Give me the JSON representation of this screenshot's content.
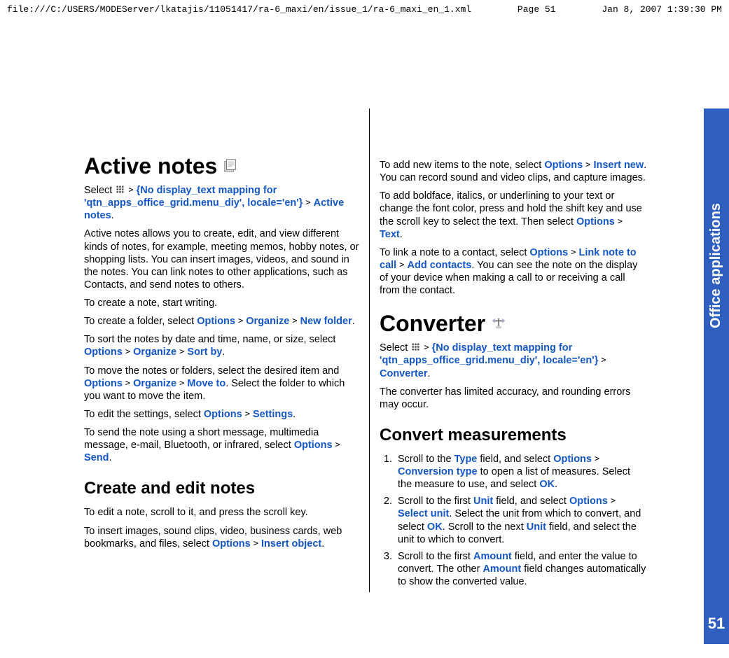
{
  "header": {
    "path": "file:///C:/USERS/MODEServer/lkatajis/11051417/ra-6_maxi/en/issue_1/ra-6_maxi_en_1.xml",
    "page": "Page 51",
    "datetime": "Jan 8, 2007 1:39:30 PM"
  },
  "side": {
    "section": "Office applications",
    "page_number": "51"
  },
  "left": {
    "h1": "Active notes",
    "p_select_pre": "Select ",
    "p_select_mapping": "{No display_text mapping for 'qtn_apps_office_grid.menu_diy', locale='en'}",
    "p_select_end": "Active notes",
    "p_desc": "Active notes allows you to create, edit, and view different kinds of notes, for example, meeting memos, hobby notes, or shopping lists. You can insert images, videos, and sound in the notes. You can link notes to other applications, such as Contacts, and send notes to others.",
    "p_create_note": "To create a note, start writing.",
    "p_folder_pre": "To create a folder, select ",
    "p_folder_opt": "Options",
    "p_folder_org": "Organize",
    "p_folder_nf": "New folder",
    "p_sort_pre": "To sort the notes by date and time, name, or size, select ",
    "p_sort_opt": "Options",
    "p_sort_org": "Organize",
    "p_sort_sb": "Sort by",
    "p_move_pre": "To move the notes or folders, select the desired item and ",
    "p_move_opt": "Options",
    "p_move_org": "Organize",
    "p_move_mt": "Move to",
    "p_move_end": ". Select the folder to which you want to move the item.",
    "p_settings_pre": "To edit the settings, select ",
    "p_settings_opt": "Options",
    "p_settings_set": "Settings",
    "p_send_pre": "To send the note using a short message, multimedia message, e-mail, Bluetooth, or infrared, select ",
    "p_send_opt": "Options",
    "p_send_snd": "Send",
    "h2": "Create and edit notes",
    "p_edit": "To edit a note, scroll to it, and press the scroll key.",
    "p_insert_pre": "To insert images, sound clips, video, business cards, web bookmarks, and files, select ",
    "p_insert_opt": "Options",
    "p_insert_obj": "Insert object"
  },
  "right": {
    "p_add_pre": "To add new items to the note, select ",
    "p_add_opt": "Options",
    "p_add_in": "Insert new",
    "p_add_end": ". You can record sound and video clips, and capture images.",
    "p_bf_pre": "To add boldface, italics, or underlining to your text or change the font color, press and hold the shift key and use the scroll key to select the text. Then select ",
    "p_bf_opt": "Options",
    "p_bf_txt": "Text",
    "p_link_pre": "To link a note to a contact, select ",
    "p_link_opt": "Options",
    "p_link_lnc": "Link note to call",
    "p_link_ac": "Add contacts",
    "p_link_end": ". You can see the note on the display of your device when making a call to or receiving a call from the contact.",
    "h1": "Converter",
    "p_sel_pre": "Select ",
    "p_sel_map": "{No display_text mapping for 'qtn_apps_office_grid.menu_diy', locale='en'}",
    "p_sel_cv": "Converter",
    "p_acc": "The converter has limited accuracy, and rounding errors may occur.",
    "h2": "Convert measurements",
    "li1_pre": "Scroll to the ",
    "li1_type": "Type",
    "li1_mid1": " field, and select ",
    "li1_opt": "Options",
    "li1_ct": "Conversion type",
    "li1_mid2": " to open a list of measures. Select the measure to use, and select ",
    "li1_ok": "OK",
    "li2_pre": "Scroll to the first ",
    "li2_unit": "Unit",
    "li2_mid1": " field, and select ",
    "li2_opt": "Options",
    "li2_su": "Select unit",
    "li2_mid2": ". Select the unit from which to convert, and select ",
    "li2_ok": "OK",
    "li2_mid3": ". Scroll to the next ",
    "li2_unit2": "Unit",
    "li2_end": " field, and select the unit to which to convert.",
    "li3_pre": "Scroll to the first ",
    "li3_am": "Amount",
    "li3_mid1": " field, and enter the value to convert. The other ",
    "li3_am2": "Amount",
    "li3_end": " field changes automatically to show the converted value."
  }
}
